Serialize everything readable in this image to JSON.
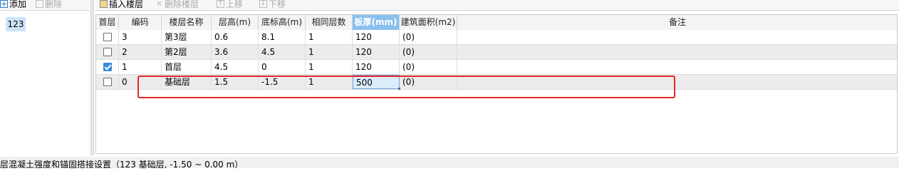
{
  "left_toolbar": {
    "add_label": "添加",
    "delete_label": "删除"
  },
  "left_list": {
    "items": [
      "123"
    ]
  },
  "right_toolbar": {
    "insert_label": "插入楼层",
    "delete_label": "删除楼层",
    "up_label": "上移",
    "down_label": "下移"
  },
  "grid": {
    "headers": [
      "首层",
      "编码",
      "楼层名称",
      "层高(m)",
      "底标高(m)",
      "相同层数",
      "板厚(mm)",
      "建筑面积(m2)",
      "备注"
    ],
    "rows": [
      {
        "checked": false,
        "code": "3",
        "name": "第3层",
        "height": "0.6",
        "bottom": "8.1",
        "same": "1",
        "thick": "120",
        "area": "(0)",
        "note": ""
      },
      {
        "checked": false,
        "code": "2",
        "name": "第2层",
        "height": "3.6",
        "bottom": "4.5",
        "same": "1",
        "thick": "120",
        "area": "(0)",
        "note": ""
      },
      {
        "checked": true,
        "code": "1",
        "name": "首层",
        "height": "4.5",
        "bottom": "0",
        "same": "1",
        "thick": "120",
        "area": "(0)",
        "note": ""
      },
      {
        "checked": false,
        "code": "0",
        "name": "基础层",
        "height": "1.5",
        "bottom": "-1.5",
        "same": "1",
        "thick": "500",
        "area": "(0)",
        "note": ""
      }
    ]
  },
  "status_text": "层混凝土强度和锚固搭接设置（123  基础层, -1.50 ~ 0.00 m）",
  "colors": {
    "selected_header": "#8ac0ee",
    "highlight_box": "#e42828",
    "checkbox_checked": "#3d8ad8"
  }
}
